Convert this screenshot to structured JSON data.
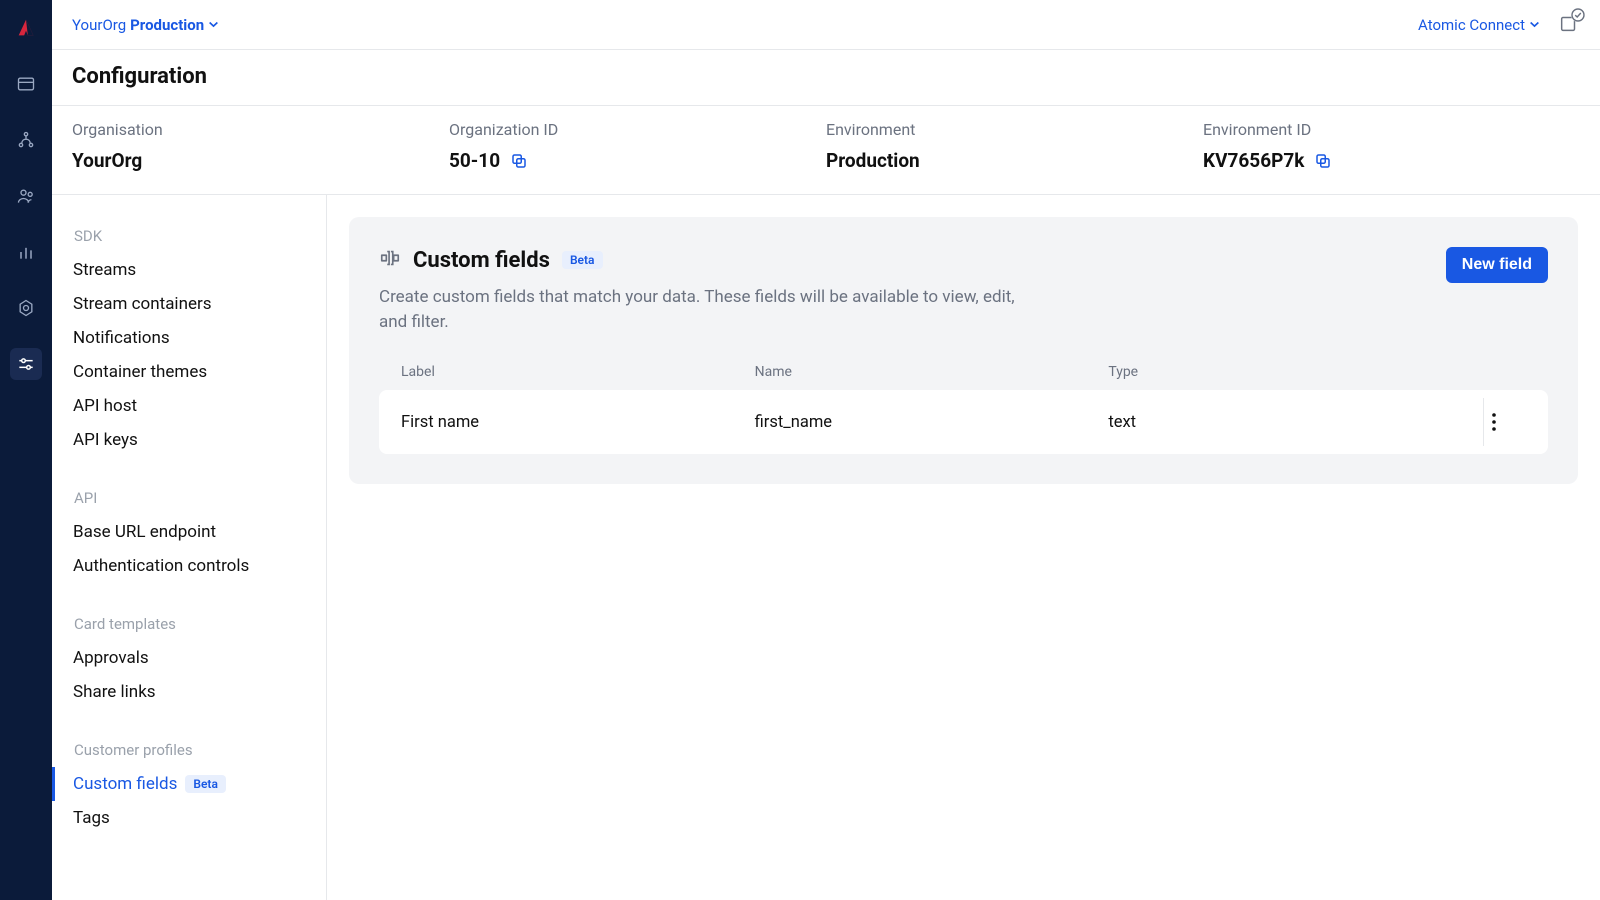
{
  "topbar": {
    "org": "YourOrg",
    "env": "Production",
    "connect_label": "Atomic Connect"
  },
  "page": {
    "title": "Configuration"
  },
  "info": {
    "org_label": "Organisation",
    "org_value": "YourOrg",
    "orgid_label": "Organization ID",
    "orgid_value": "50-10",
    "env_label": "Environment",
    "env_value": "Production",
    "envid_label": "Environment ID",
    "envid_value": "KV7656P7k"
  },
  "sidenav": {
    "groups": [
      {
        "label": "SDK",
        "items": [
          "Streams",
          "Stream containers",
          "Notifications",
          "Container themes",
          "API host",
          "API keys"
        ]
      },
      {
        "label": "API",
        "items": [
          "Base URL endpoint",
          "Authentication controls"
        ]
      },
      {
        "label": "Card templates",
        "items": [
          "Approvals",
          "Share links"
        ]
      },
      {
        "label": "Customer profiles",
        "items": [
          "Custom fields",
          "Tags"
        ]
      }
    ],
    "beta_label": "Beta"
  },
  "card": {
    "title": "Custom fields",
    "badge": "Beta",
    "desc": "Create custom fields that match your data. These fields will be available to view, edit, and filter.",
    "new_label": "New field"
  },
  "table": {
    "cols": {
      "label": "Label",
      "name": "Name",
      "type": "Type"
    },
    "rows": [
      {
        "label": "First name",
        "name": "first_name",
        "type": "text"
      }
    ]
  }
}
